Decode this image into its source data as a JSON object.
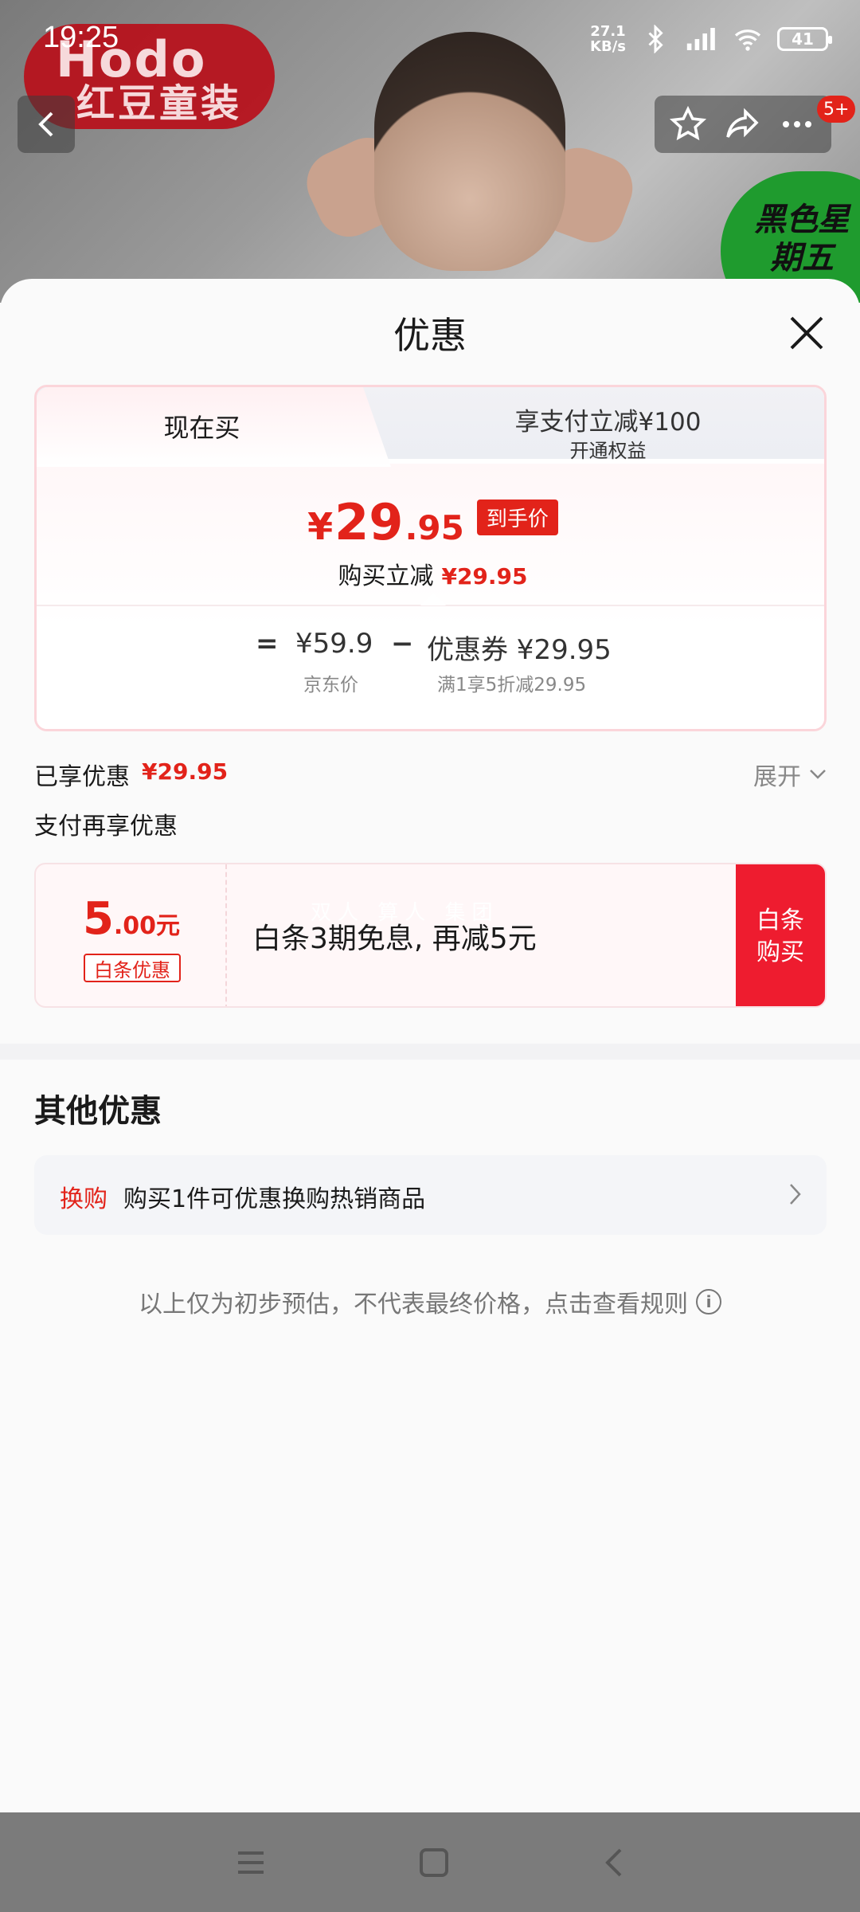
{
  "status_bar": {
    "time": "19:25",
    "net_speed_value": "27.1",
    "net_speed_unit": "KB/s",
    "battery": "41"
  },
  "background": {
    "brand_en": "Hodo",
    "brand_cn": "红豆童装",
    "promo": "黑色星期五"
  },
  "top_nav": {
    "badge": "5+"
  },
  "sheet": {
    "title": "优惠",
    "tabs": {
      "now_buy": "现在买",
      "pay_discount_title": "享支付立减¥100",
      "pay_discount_sub": "开通权益"
    },
    "price": {
      "yen": "¥",
      "integer": "29",
      "decimal": ".95",
      "tag": "到手价",
      "discount_label": "购买立减",
      "discount_amount": "¥29.95"
    },
    "formula": {
      "equals": "=",
      "jd_price": "¥59.9",
      "minus": "−",
      "coupon": "优惠券 ¥29.95",
      "jd_price_label": "京东价",
      "coupon_label": "满1享5折减29.95"
    },
    "enjoyed": {
      "label": "已享优惠",
      "amount": "¥29.95",
      "expand": "展开"
    },
    "pay_extra_label": "支付再享优惠",
    "baitiao": {
      "amount_int": "5",
      "amount_dec": ".00元",
      "tag": "白条优惠",
      "description": "白条3期免息, 再减5元",
      "watermark": "双人 算人 集团",
      "buy_button": "白条购买"
    },
    "other": {
      "title": "其他优惠",
      "swap_tag": "换购",
      "swap_text": "购买1件可优惠换购热销商品"
    },
    "disclaimer": "以上仅为初步预估，不代表最终价格，点击查看规则"
  },
  "colors": {
    "accent_red": "#e2231a",
    "buy_red": "#ee1c2f"
  }
}
